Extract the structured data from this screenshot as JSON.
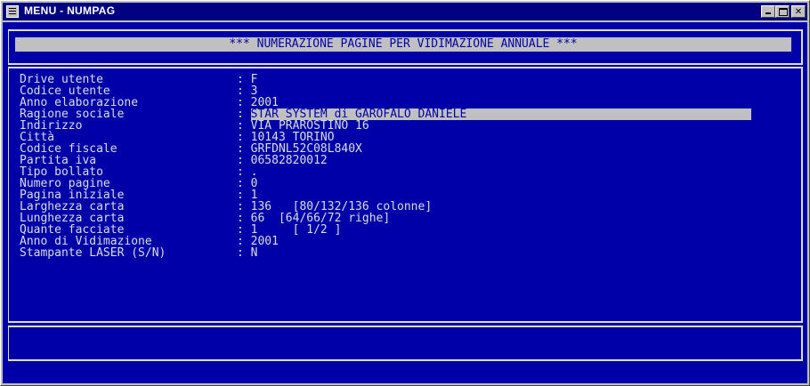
{
  "window": {
    "title": "MENU - NUMPAG"
  },
  "header": {
    "text": "*** NUMERAZIONE PAGINE PER VIDIMAZIONE ANNUALE ***"
  },
  "fields": [
    {
      "label": "Drive utente",
      "value": "F"
    },
    {
      "label": "Codice utente",
      "value": "3"
    },
    {
      "label": "Anno elaborazione",
      "value": "2001"
    },
    {
      "label": "Ragione sociale",
      "value": "STAR SYSTEM di GAROFALO DANIELE"
    },
    {
      "label": "Indirizzo",
      "value": "VIA PRAROSTINO 16"
    },
    {
      "label": "Città",
      "value": "10143 TORINO"
    },
    {
      "label": "Codice fiscale",
      "value": "GRFDNL52C08L840X"
    },
    {
      "label": "Partita iva",
      "value": "06582820012"
    },
    {
      "label": "Tipo bollato",
      "value": "."
    },
    {
      "label": "Numero pagine",
      "value": "0"
    },
    {
      "label": "Pagina iniziale",
      "value": "1"
    },
    {
      "label": "Larghezza carta",
      "value": "136   [80/132/136 colonne]"
    },
    {
      "label": "Lunghezza carta",
      "value": "66  [64/66/72 righe]"
    },
    {
      "label": "Quante facciate",
      "value": "1     [ 1/2 ]"
    },
    {
      "label": "Anno di Vidimazione",
      "value": "2001"
    },
    {
      "label": "Stampante LASER (S/N)",
      "value": "N"
    }
  ],
  "separator": ":"
}
